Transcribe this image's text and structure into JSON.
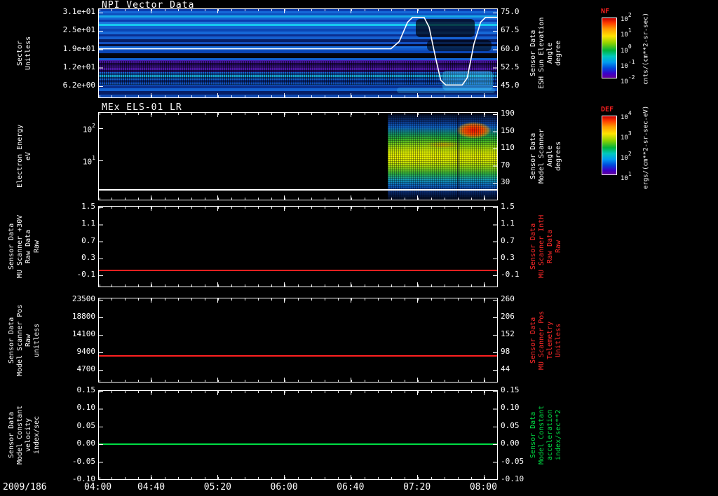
{
  "colors": {
    "background": "#000000",
    "axis_text": "#ffffff",
    "red_label": "#ff2a2a",
    "green_label": "#00dd44",
    "colorbar_title_red": "#ff2020",
    "line_red": "#ff2020",
    "line_green": "#00dd44",
    "overlay_white": "#ffffff"
  },
  "x_axis": {
    "date": "2009/186",
    "first_tick": "04:00",
    "ticks": [
      "04:40",
      "05:20",
      "06:00",
      "06:40",
      "07:20",
      "08:00"
    ]
  },
  "panels": [
    {
      "title": "NPI Vector Data",
      "left_label": "Sector\nUnitless",
      "left_ticks": [
        "3.1e+01",
        "2.5e+01",
        "1.9e+01",
        "1.2e+01",
        "6.2e+00"
      ],
      "right_label": "Sensor Data\nESH Sun Elevation\nAngle\ndegree",
      "right_ticks": [
        "75.0",
        "67.5",
        "60.0",
        "52.5",
        "45.0"
      ],
      "colorbar": {
        "title": "NF",
        "units": "cnts/(cm**2-sr-sec)",
        "ticks": [
          "10^2",
          "10^1",
          "10^0",
          "10^-1",
          "10^-2"
        ]
      }
    },
    {
      "title": "MEx ELS-01 LR",
      "left_label": "Electron Energy\neV",
      "left_ticks": [
        "10^2",
        "10^1"
      ],
      "right_label": "Sensor Data\nModel Scanner\nAngle\ndegrees",
      "right_ticks": [
        "190",
        "150",
        "110",
        "70",
        "30"
      ],
      "colorbar": {
        "title": "DEF",
        "units": "ergs/(cm**2-sr-sec-eV)",
        "ticks": [
          "10^4",
          "10^3",
          "10^2",
          "10^1"
        ]
      }
    },
    {
      "left_label": "Sensor Data\nMU Scanner +30V\nRaw Data\nRaw",
      "left_ticks": [
        "1.5",
        "1.1",
        "0.7",
        "0.3",
        "-0.1"
      ],
      "right_label": "Sensor Data\nMU Scanner IntH\nRaw Data\nRaw",
      "right_ticks": [
        "1.5",
        "1.1",
        "0.7",
        "0.3",
        "-0.1"
      ],
      "right_label_color": "#ff2a2a"
    },
    {
      "left_label": "Sensor Data\nModel Scanner Pos\nRaw\nunitless",
      "left_ticks": [
        "23500",
        "18800",
        "14100",
        "9400",
        "4700"
      ],
      "right_label": "Sensor Data\nMU Scanner Pos\nTelemetry\nUnitless",
      "right_ticks": [
        "260",
        "206",
        "152",
        "98",
        "44"
      ],
      "right_label_color": "#ff2a2a"
    },
    {
      "left_label": "Sensor Data\nModel Constant\nvelocity\nindex/sec",
      "left_ticks": [
        "0.15",
        "0.10",
        "0.05",
        "0.00",
        "-0.05",
        "-0.10"
      ],
      "right_label": "Sensor Data\nModel Constant\nacceleration\nindex/sec**2",
      "right_ticks": [
        "0.15",
        "0.10",
        "0.05",
        "0.00",
        "-0.05",
        "-0.10"
      ],
      "right_label_color": "#00dd44"
    }
  ],
  "chart_data": [
    {
      "type": "heatmap",
      "title": "NPI Vector Data",
      "ylabel": "Sector (Unitless)",
      "ytick_values": [
        31,
        25,
        19,
        12,
        6.2
      ],
      "x_range": [
        "2009/186 04:00",
        "2009/186 08:00"
      ],
      "duration_min": 240,
      "xticks": [
        "04:00",
        "04:40",
        "05:20",
        "06:00",
        "06:40",
        "07:20",
        "08:00"
      ],
      "colorbar": {
        "name": "NF",
        "units": "cnts/(cm**2-sr-sec)",
        "scale": "log",
        "ticks": [
          "10^2",
          "10^1",
          "10^0",
          "10^-1",
          "10^-2"
        ]
      },
      "right_axis": {
        "label": "Sensor Data ESH Sun Elevation Angle (degree)",
        "range": [
          45,
          75
        ],
        "ticks": [
          75.0,
          67.5,
          60.0,
          52.5,
          45.0
        ]
      },
      "overlay_line": {
        "name": "ESH Sun Elevation Angle",
        "color": "#ffffff",
        "units": "degree",
        "x_units": "minutes after 04:00",
        "points": [
          [
            0,
            60
          ],
          [
            176,
            60
          ],
          [
            181,
            63
          ],
          [
            186,
            71
          ],
          [
            189,
            73
          ],
          [
            196,
            73
          ],
          [
            199,
            69
          ],
          [
            203,
            56
          ],
          [
            206,
            47
          ],
          [
            209,
            45
          ],
          [
            219,
            45
          ],
          [
            222,
            48
          ],
          [
            226,
            62
          ],
          [
            230,
            71
          ],
          [
            233,
            73
          ],
          [
            240,
            73
          ]
        ]
      },
      "rows": [
        [
          3,
          "#0a3cae"
        ],
        [
          3,
          "#1668d8"
        ],
        [
          3,
          "#0c50c0"
        ],
        [
          3,
          "#18a8e8"
        ],
        [
          4,
          "#1466d4"
        ],
        [
          3,
          "#0a3cae"
        ],
        [
          3,
          "#1a74dc"
        ],
        [
          3,
          "#16c8f0"
        ],
        [
          4,
          "#1261d0"
        ],
        [
          4,
          "#0b46b4"
        ],
        [
          4,
          "#1668d8"
        ],
        [
          4,
          "#0a2f92"
        ],
        [
          4,
          "#155fd0"
        ],
        [
          4,
          "#071f66"
        ],
        [
          3,
          "#134fc0"
        ],
        [
          3,
          "#050f3a"
        ],
        [
          3,
          "#1668d8"
        ],
        [
          3,
          "#1157c8"
        ],
        [
          4,
          "#0b46b4"
        ],
        [
          4,
          "#04060f"
        ],
        [
          4,
          "#03050c"
        ],
        [
          3,
          "#1261d0"
        ],
        [
          4,
          "#4a16a8"
        ],
        [
          5,
          "#2a0a70"
        ],
        [
          5,
          "#5a1cc0"
        ],
        [
          4,
          "#30128a"
        ],
        [
          4,
          "#1668d8"
        ],
        [
          3,
          "#18b8ec"
        ],
        [
          4,
          "#1261d0"
        ],
        [
          4,
          "#0a3cae"
        ],
        [
          4,
          "#155fd0"
        ],
        [
          4,
          "#0a2f8e"
        ],
        [
          5,
          "#1261d0"
        ],
        [
          5,
          "#071f66"
        ],
        [
          4,
          "#0c46b0"
        ]
      ],
      "description": "Blue/cyan horizontally banded sector spectrogram with dark and purple speckled bands; disturbed patch 06:55-08:00 under the white sun-elevation excursion"
    },
    {
      "type": "heatmap",
      "title": "MEx ELS-01 LR",
      "ylabel": "Electron Energy (eV)",
      "yscale": "log",
      "ylim": [
        0.6,
        300
      ],
      "yticks": [
        "10^2",
        "10^1"
      ],
      "right_axis": {
        "label": "Sensor Data Model Scanner Angle (degrees)",
        "ticks": [
          190,
          150,
          110,
          70,
          30
        ]
      },
      "colorbar": {
        "name": "DEF",
        "units": "ergs/(cm**2-sr-sec-eV)",
        "scale": "log",
        "ticks": [
          "10^4",
          "10^3",
          "10^2",
          "10^1"
        ]
      },
      "data_coverage": "no data 04:00-06:53; spectrogram present 06:53-08:00",
      "features": [
        "broad green-yellow flux band ~10-60 eV",
        "intense red patch ~80-150 eV between 07:25-07:50",
        "white baseline line near lowest energy across full time range"
      ]
    },
    {
      "type": "line",
      "ylabel": "Sensor Data MU Scanner +30V Raw Data (Raw)",
      "ylim": [
        -0.4,
        1.5
      ],
      "yticks": [
        1.5,
        1.1,
        0.7,
        0.3,
        -0.1
      ],
      "right_axis": {
        "label": "Sensor Data MU Scanner IntH Raw Data (Raw)",
        "ticks": [
          1.5,
          1.1,
          0.7,
          0.3,
          -0.1
        ]
      },
      "series": [
        {
          "name": "MU Scanner +30V",
          "color": "#ff2020",
          "constant_value": 0.0
        }
      ]
    },
    {
      "type": "line",
      "ylabel": "Sensor Data Model Scanner Pos Raw (unitless)",
      "ylim": [
        1300,
        23900
      ],
      "yticks": [
        23500,
        18800,
        14100,
        9400,
        4700
      ],
      "right_axis": {
        "label": "Sensor Data MU Scanner Pos Telemetry (Unitless)",
        "ticks": [
          260,
          206,
          152,
          98,
          44
        ]
      },
      "series": [
        {
          "name": "Model Scanner Pos",
          "color": "#ff2020",
          "constant_value": 8600
        }
      ]
    },
    {
      "type": "line",
      "ylabel": "Sensor Data Model Constant velocity (index/sec)",
      "ylim": [
        -0.102,
        0.15
      ],
      "yticks": [
        0.15,
        0.1,
        0.05,
        0.0,
        -0.05,
        -0.1
      ],
      "right_axis": {
        "label": "Sensor Data Model Constant acceleration (index/sec**2)",
        "ticks": [
          0.15,
          0.1,
          0.05,
          0.0,
          -0.05,
          -0.1
        ]
      },
      "series": [
        {
          "name": "Model Constant velocity",
          "color": "#00dd44",
          "constant_value": 0.0
        }
      ]
    }
  ]
}
